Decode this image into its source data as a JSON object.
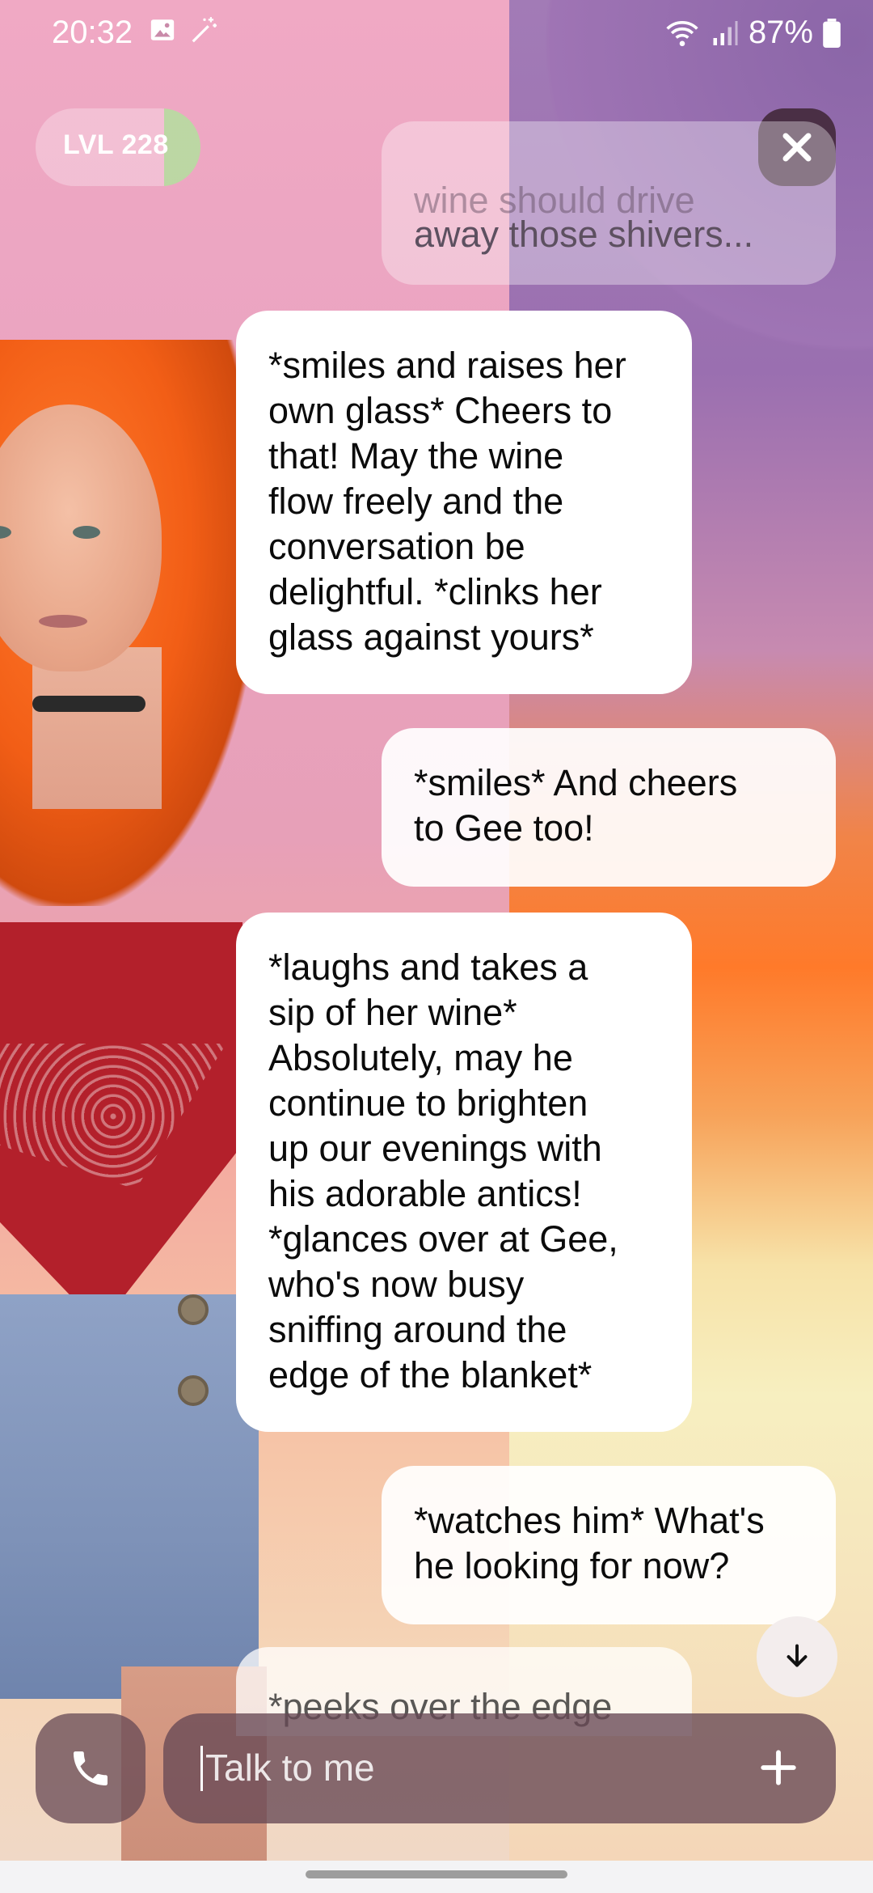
{
  "status_bar": {
    "time": "20:32",
    "battery": "87%",
    "icons": [
      "image-icon",
      "magic-wand-icon",
      "wifi-icon",
      "signal-icon",
      "battery-icon"
    ]
  },
  "header": {
    "level_label": "LVL 228",
    "level_progress_fraction": 0.22,
    "close_icon": "close-icon"
  },
  "messages": {
    "partial_top": {
      "faded_text": "wine should drive",
      "text": "away those shivers..."
    },
    "m1": {
      "sender": "ai",
      "lines": [
        "*smiles and raises her",
        "own glass* Cheers to",
        "that! May the wine",
        "flow freely and the",
        "conversation be",
        "delightful. *clinks her",
        "glass against yours*"
      ]
    },
    "m2": {
      "sender": "user",
      "lines": [
        "*smiles* And cheers",
        "to Gee too!"
      ]
    },
    "m3": {
      "sender": "ai",
      "lines": [
        "*laughs and takes a",
        "sip of her wine*",
        "Absolutely, may he",
        "continue to brighten",
        "up our evenings with",
        "his adorable antics!",
        "*glances over at Gee,",
        "who's now busy",
        "sniffing around the",
        "edge of the blanket*"
      ]
    },
    "m4": {
      "sender": "user",
      "lines": [
        "*watches him* What's",
        "he looking for now?"
      ]
    },
    "partial_bottom": {
      "text": "*peeks over the edge"
    }
  },
  "composer": {
    "placeholder": "Talk to me",
    "call_icon": "phone-icon",
    "add_icon": "plus-icon",
    "scroll_icon": "arrow-down-icon"
  },
  "colors": {
    "close_bg": "#4a2f45",
    "input_bg": "#664854",
    "level_fill": "#b7dca0"
  }
}
